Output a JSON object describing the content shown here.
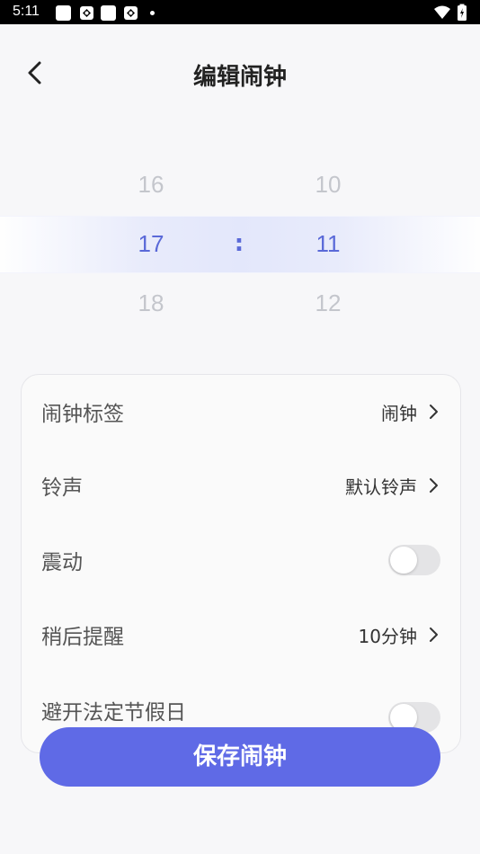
{
  "status_bar": {
    "time": "5:11"
  },
  "header": {
    "title": "编辑闹钟"
  },
  "picker": {
    "hour": {
      "prev": "16",
      "selected": "17",
      "next": "18"
    },
    "minute": {
      "prev": "10",
      "selected": "11",
      "next": "12"
    },
    "separator": ":"
  },
  "settings": {
    "rows": [
      {
        "label": "闹钟标签",
        "value": "闹钟",
        "type": "link"
      },
      {
        "label": "铃声",
        "value": "默认铃声",
        "type": "link"
      },
      {
        "label": "震动",
        "type": "toggle",
        "on": false
      },
      {
        "label": "稍后提醒",
        "value": "10分钟",
        "type": "link"
      },
      {
        "label": "避开法定节假日",
        "type": "toggle",
        "on": false
      }
    ]
  },
  "save_button": {
    "label": "保存闹钟"
  },
  "colors": {
    "accent": "#5f6ae6",
    "picker_selected": "#5a69d8",
    "background": "#f7f7f9"
  }
}
